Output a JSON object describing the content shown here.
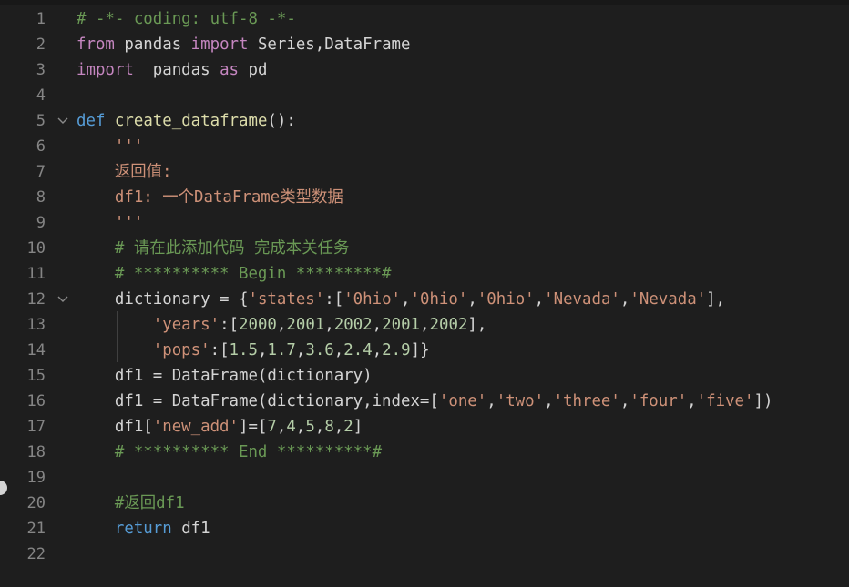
{
  "editor": {
    "language": "python",
    "lines": [
      {
        "num": "1",
        "fold": false,
        "tokens": [
          {
            "t": "# -*- coding: utf-8 -*-",
            "c": "cmt"
          }
        ]
      },
      {
        "num": "2",
        "fold": false,
        "tokens": [
          {
            "t": "from",
            "c": "kw2"
          },
          {
            "t": " pandas ",
            "c": "plain"
          },
          {
            "t": "import",
            "c": "kw2"
          },
          {
            "t": " Series,DataFrame",
            "c": "plain"
          }
        ]
      },
      {
        "num": "3",
        "fold": false,
        "tokens": [
          {
            "t": "import",
            "c": "kw2"
          },
          {
            "t": "  pandas ",
            "c": "plain"
          },
          {
            "t": "as",
            "c": "kw2"
          },
          {
            "t": " pd",
            "c": "plain"
          }
        ]
      },
      {
        "num": "4",
        "fold": false,
        "tokens": []
      },
      {
        "num": "5",
        "fold": true,
        "tokens": [
          {
            "t": "def",
            "c": "kw"
          },
          {
            "t": " ",
            "c": "plain"
          },
          {
            "t": "create_dataframe",
            "c": "fn"
          },
          {
            "t": "():",
            "c": "plain"
          }
        ]
      },
      {
        "num": "6",
        "fold": false,
        "tokens": [
          {
            "t": "    '''",
            "c": "str"
          }
        ]
      },
      {
        "num": "7",
        "fold": false,
        "tokens": [
          {
            "t": "    返回值:",
            "c": "str"
          }
        ]
      },
      {
        "num": "8",
        "fold": false,
        "tokens": [
          {
            "t": "    df1: 一个DataFrame类型数据",
            "c": "str"
          }
        ]
      },
      {
        "num": "9",
        "fold": false,
        "tokens": [
          {
            "t": "    '''",
            "c": "str"
          }
        ]
      },
      {
        "num": "10",
        "fold": false,
        "tokens": [
          {
            "t": "    # 请在此添加代码 完成本关任务",
            "c": "cmt"
          }
        ]
      },
      {
        "num": "11",
        "fold": false,
        "tokens": [
          {
            "t": "    # ********** Begin *********#",
            "c": "cmt"
          }
        ]
      },
      {
        "num": "12",
        "fold": true,
        "tokens": [
          {
            "t": "    dictionary = {",
            "c": "plain"
          },
          {
            "t": "'states'",
            "c": "str"
          },
          {
            "t": ":[",
            "c": "plain"
          },
          {
            "t": "'0hio'",
            "c": "str"
          },
          {
            "t": ",",
            "c": "plain"
          },
          {
            "t": "'0hio'",
            "c": "str"
          },
          {
            "t": ",",
            "c": "plain"
          },
          {
            "t": "'0hio'",
            "c": "str"
          },
          {
            "t": ",",
            "c": "plain"
          },
          {
            "t": "'Nevada'",
            "c": "str"
          },
          {
            "t": ",",
            "c": "plain"
          },
          {
            "t": "'Nevada'",
            "c": "str"
          },
          {
            "t": "],",
            "c": "plain"
          }
        ]
      },
      {
        "num": "13",
        "fold": false,
        "tokens": [
          {
            "t": "        ",
            "c": "plain"
          },
          {
            "t": "'years'",
            "c": "str"
          },
          {
            "t": ":[",
            "c": "plain"
          },
          {
            "t": "2000",
            "c": "num"
          },
          {
            "t": ",",
            "c": "plain"
          },
          {
            "t": "2001",
            "c": "num"
          },
          {
            "t": ",",
            "c": "plain"
          },
          {
            "t": "2002",
            "c": "num"
          },
          {
            "t": ",",
            "c": "plain"
          },
          {
            "t": "2001",
            "c": "num"
          },
          {
            "t": ",",
            "c": "plain"
          },
          {
            "t": "2002",
            "c": "num"
          },
          {
            "t": "],",
            "c": "plain"
          }
        ]
      },
      {
        "num": "14",
        "fold": false,
        "tokens": [
          {
            "t": "        ",
            "c": "plain"
          },
          {
            "t": "'pops'",
            "c": "str"
          },
          {
            "t": ":[",
            "c": "plain"
          },
          {
            "t": "1.5",
            "c": "num"
          },
          {
            "t": ",",
            "c": "plain"
          },
          {
            "t": "1.7",
            "c": "num"
          },
          {
            "t": ",",
            "c": "plain"
          },
          {
            "t": "3.6",
            "c": "num"
          },
          {
            "t": ",",
            "c": "plain"
          },
          {
            "t": "2.4",
            "c": "num"
          },
          {
            "t": ",",
            "c": "plain"
          },
          {
            "t": "2.9",
            "c": "num"
          },
          {
            "t": "]}",
            "c": "plain"
          }
        ]
      },
      {
        "num": "15",
        "fold": false,
        "tokens": [
          {
            "t": "    df1 = DataFrame(dictionary)",
            "c": "plain"
          }
        ]
      },
      {
        "num": "16",
        "fold": false,
        "tokens": [
          {
            "t": "    df1 = DataFrame(dictionary,index=[",
            "c": "plain"
          },
          {
            "t": "'one'",
            "c": "str"
          },
          {
            "t": ",",
            "c": "plain"
          },
          {
            "t": "'two'",
            "c": "str"
          },
          {
            "t": ",",
            "c": "plain"
          },
          {
            "t": "'three'",
            "c": "str"
          },
          {
            "t": ",",
            "c": "plain"
          },
          {
            "t": "'four'",
            "c": "str"
          },
          {
            "t": ",",
            "c": "plain"
          },
          {
            "t": "'five'",
            "c": "str"
          },
          {
            "t": "])",
            "c": "plain"
          }
        ]
      },
      {
        "num": "17",
        "fold": false,
        "tokens": [
          {
            "t": "    df1[",
            "c": "plain"
          },
          {
            "t": "'new_add'",
            "c": "str"
          },
          {
            "t": "]=[",
            "c": "plain"
          },
          {
            "t": "7",
            "c": "num"
          },
          {
            "t": ",",
            "c": "plain"
          },
          {
            "t": "4",
            "c": "num"
          },
          {
            "t": ",",
            "c": "plain"
          },
          {
            "t": "5",
            "c": "num"
          },
          {
            "t": ",",
            "c": "plain"
          },
          {
            "t": "8",
            "c": "num"
          },
          {
            "t": ",",
            "c": "plain"
          },
          {
            "t": "2",
            "c": "num"
          },
          {
            "t": "]",
            "c": "plain"
          }
        ]
      },
      {
        "num": "18",
        "fold": false,
        "tokens": [
          {
            "t": "    # ********** End **********#",
            "c": "cmt"
          }
        ]
      },
      {
        "num": "19",
        "fold": false,
        "tokens": []
      },
      {
        "num": "20",
        "fold": false,
        "tokens": [
          {
            "t": "    #返回df1",
            "c": "cmt"
          }
        ]
      },
      {
        "num": "21",
        "fold": false,
        "tokens": [
          {
            "t": "    ",
            "c": "plain"
          },
          {
            "t": "return",
            "c": "kw"
          },
          {
            "t": " df1",
            "c": "plain"
          }
        ]
      },
      {
        "num": "22",
        "fold": false,
        "tokens": []
      }
    ]
  },
  "colors": {
    "background": "#1e1e1e",
    "line_number": "#858585",
    "keyword": "#569cd6",
    "import_keyword": "#c586c0",
    "function": "#dcdcaa",
    "string": "#ce9178",
    "comment": "#6a9955",
    "number": "#b5cea8",
    "plain": "#d4d4d4"
  }
}
